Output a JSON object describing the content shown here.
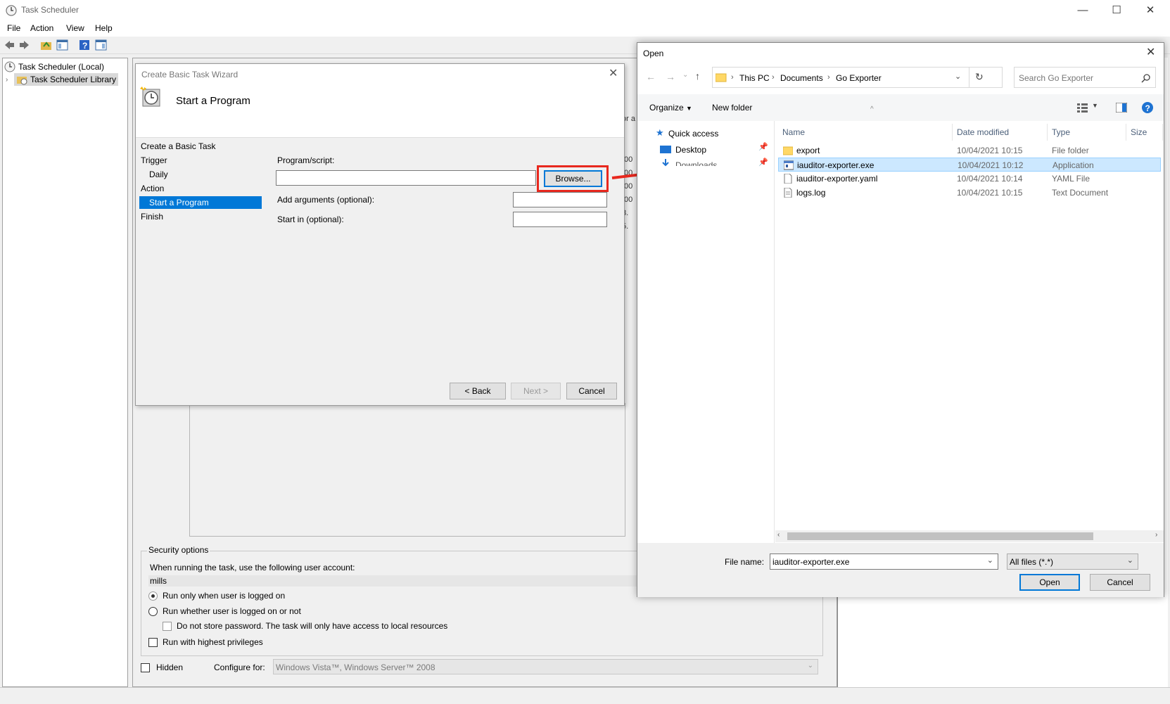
{
  "window": {
    "title": "Task Scheduler",
    "controls": [
      "—",
      "☐",
      "✕"
    ]
  },
  "menu": [
    "File",
    "Action",
    "View",
    "Help"
  ],
  "tree": {
    "root": "Task Scheduler (Local)",
    "library": "Task Scheduler Library"
  },
  "wizard": {
    "title": "Create Basic Task Wizard",
    "heading": "Start a Program",
    "steps": [
      {
        "label": "Create a Basic Task"
      },
      {
        "label": "Trigger"
      },
      {
        "label": "Daily"
      },
      {
        "label": "Action"
      },
      {
        "label": "Start a Program"
      },
      {
        "label": "Finish"
      }
    ],
    "program_label": "Program/script:",
    "program_value": "",
    "browse": "Browse...",
    "args_label": "Add arguments (optional):",
    "start_label": "Start in (optional):",
    "back": "< Back",
    "next": "Next >",
    "cancel": "Cancel"
  },
  "background_fragments": [
    "or a",
    ":00",
    ":00",
    ":00",
    ":00",
    "3.",
    "5."
  ],
  "security": {
    "title": "Security options",
    "account_prompt": "When running the task, use the following user account:",
    "account": "mills",
    "radio1": "Run only when user is logged on",
    "radio2": "Run whether user is logged on or not",
    "no_store": "Do not store password.  The task will only have access to local resources",
    "highest": "Run with highest privileges",
    "hidden": "Hidden",
    "configure_label": "Configure for:",
    "configure_value": "Windows Vista™, Windows Server™ 2008"
  },
  "open_dialog": {
    "title": "Open",
    "breadcrumb": [
      "This PC",
      "Documents",
      "Go Exporter"
    ],
    "search_placeholder": "Search Go Exporter",
    "organize": "Organize",
    "new_folder": "New folder",
    "nav": [
      "Quick access",
      "Desktop",
      "Downloads"
    ],
    "columns": [
      "Name",
      "Date modified",
      "Type",
      "Size"
    ],
    "files": [
      {
        "name": "export",
        "date": "10/04/2021 10:15",
        "type": "File folder",
        "icon": "folder-icon"
      },
      {
        "name": "iauditor-exporter.exe",
        "date": "10/04/2021 10:12",
        "type": "Application",
        "icon": "application-icon"
      },
      {
        "name": "iauditor-exporter.yaml",
        "date": "10/04/2021 10:14",
        "type": "YAML File",
        "icon": "file-icon"
      },
      {
        "name": "logs.log",
        "date": "10/04/2021 10:15",
        "type": "Text Document",
        "icon": "text-file-icon"
      }
    ],
    "filename_label": "File name:",
    "filename_value": "iauditor-exporter.exe",
    "filetype": "All files (*.*)",
    "open": "Open",
    "cancel": "Cancel"
  },
  "colors": {
    "accent": "#0078d7",
    "highlight_box": "#e8281e",
    "selection": "#cce8ff"
  }
}
